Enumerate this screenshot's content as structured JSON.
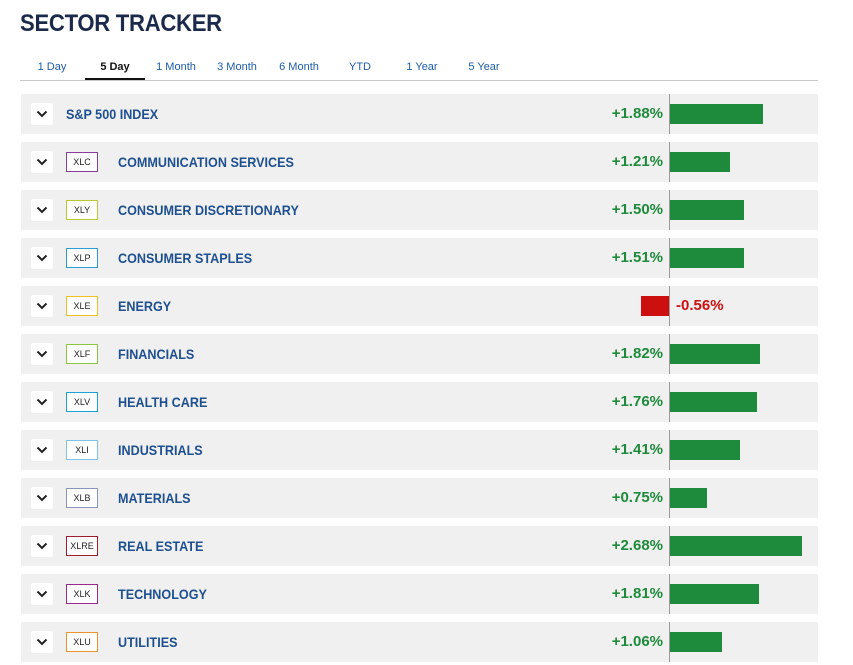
{
  "title": "SECTOR TRACKER",
  "tabs": [
    {
      "label": "1 Day",
      "active": false
    },
    {
      "label": "5 Day",
      "active": true
    },
    {
      "label": "1 Month",
      "active": false
    },
    {
      "label": "3 Month",
      "active": false
    },
    {
      "label": "6 Month",
      "active": false
    },
    {
      "label": "YTD",
      "active": false
    },
    {
      "label": "1 Year",
      "active": false
    },
    {
      "label": "5 Year",
      "active": false
    }
  ],
  "colors": {
    "positive": "#1e8a3b",
    "negative": "#cc1010",
    "name_text": "#1d4f91",
    "tab_text": "#1d5da8"
  },
  "icons": {
    "expand": "chevron-down-icon"
  },
  "rows": [
    {
      "ticker": "",
      "name": "S&P 500 INDEX",
      "change_label": "+1.88%",
      "change": 1.88,
      "badge_color": ""
    },
    {
      "ticker": "XLC",
      "name": "COMMUNICATION SERVICES",
      "change_label": "+1.21%",
      "change": 1.21,
      "badge_color": "#8a3e9c"
    },
    {
      "ticker": "XLY",
      "name": "CONSUMER DISCRETIONARY",
      "change_label": "+1.50%",
      "change": 1.5,
      "badge_color": "#b8c930"
    },
    {
      "ticker": "XLP",
      "name": "CONSUMER STAPLES",
      "change_label": "+1.51%",
      "change": 1.51,
      "badge_color": "#2a9fd6"
    },
    {
      "ticker": "XLE",
      "name": "ENERGY",
      "change_label": "-0.56%",
      "change": -0.56,
      "badge_color": "#f0c020"
    },
    {
      "ticker": "XLF",
      "name": "FINANCIALS",
      "change_label": "+1.82%",
      "change": 1.82,
      "badge_color": "#8cc63f"
    },
    {
      "ticker": "XLV",
      "name": "HEALTH CARE",
      "change_label": "+1.76%",
      "change": 1.76,
      "badge_color": "#1aa3d9"
    },
    {
      "ticker": "XLI",
      "name": "INDUSTRIALS",
      "change_label": "+1.41%",
      "change": 1.41,
      "badge_color": "#7fc4e8"
    },
    {
      "ticker": "XLB",
      "name": "MATERIALS",
      "change_label": "+0.75%",
      "change": 0.75,
      "badge_color": "#8a96b8"
    },
    {
      "ticker": "XLRE",
      "name": "REAL ESTATE",
      "change_label": "+2.68%",
      "change": 2.68,
      "badge_color": "#9c1c2e"
    },
    {
      "ticker": "XLK",
      "name": "TECHNOLOGY",
      "change_label": "+1.81%",
      "change": 1.81,
      "badge_color": "#9c2a8e"
    },
    {
      "ticker": "XLU",
      "name": "UTILITIES",
      "change_label": "+1.06%",
      "change": 1.06,
      "badge_color": "#f0922a"
    }
  ]
}
